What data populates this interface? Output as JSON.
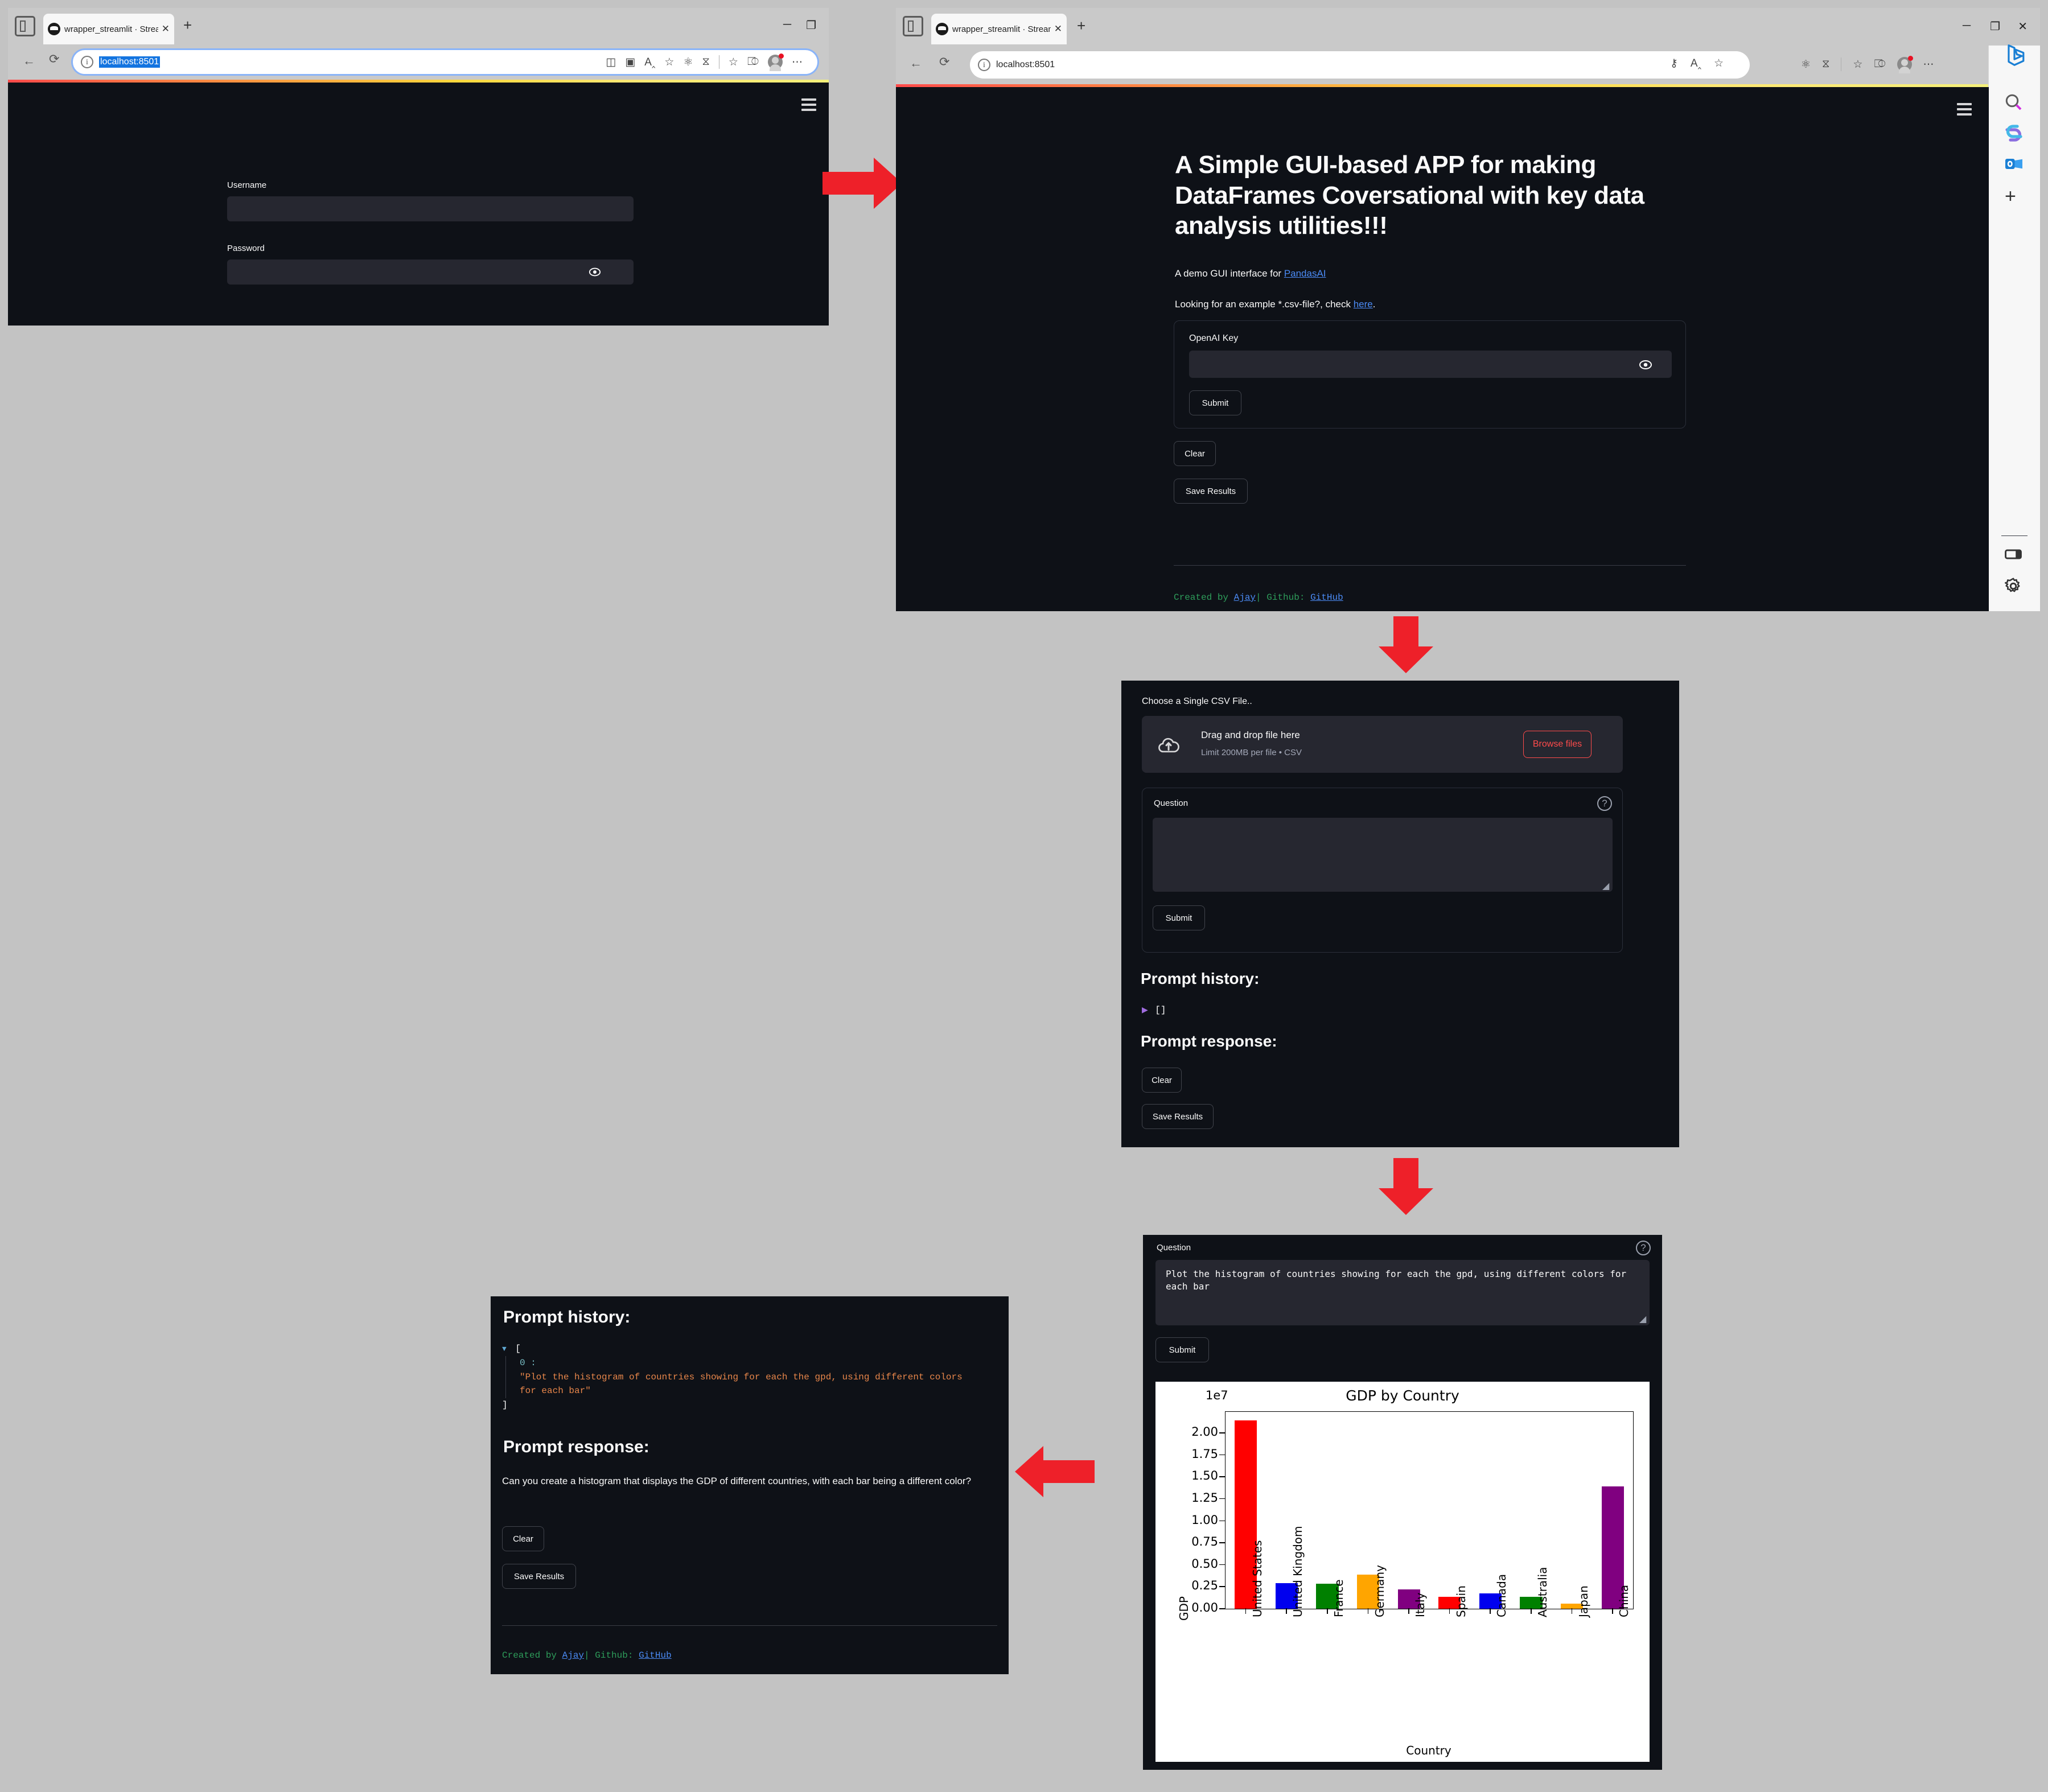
{
  "panel1": {
    "browser": {
      "tab_title": "wrapper_streamlit · Streamlit",
      "tab_close": "✕",
      "new_tab": "+",
      "url": "localhost:8501",
      "minimize": "─",
      "restore": "❐",
      "back_icon": "back-arrow-icon",
      "refresh_icon": "refresh-icon"
    },
    "form": {
      "username_label": "Username",
      "username_value": "",
      "password_label": "Password",
      "password_value": ""
    }
  },
  "panel2": {
    "browser": {
      "tab_title": "wrapper_streamlit · Streamlit",
      "tab_close": "✕",
      "new_tab": "+",
      "url": "localhost:8501",
      "minimize": "─",
      "restore": "❐",
      "close": "✕"
    },
    "hero_title": "A Simple GUI-based APP for making DataFrames Coversational with key data analysis utilities!!!",
    "demo_text_pre": "A demo GUI interface for ",
    "demo_link": "PandasAI",
    "example_text_pre": "Looking for an example *.csv-file?, check ",
    "example_link": "here",
    "example_text_post": ".",
    "openai_key_label": "OpenAI Key",
    "openai_key_value": "",
    "submit_label": "Submit",
    "clear_label": "Clear",
    "save_results_label": "Save Results",
    "footer": {
      "created_by": "Created by",
      "author": "Ajay",
      "separator": "|",
      "github_label": "Github:",
      "github_link": "GitHub"
    }
  },
  "panel3": {
    "file_label": "Choose a Single CSV File..",
    "dropzone_title": "Drag and drop file here",
    "dropzone_limit": "Limit 200MB per file • CSV",
    "browse_label": "Browse files",
    "question_label": "Question",
    "question_value": "",
    "submit_label": "Submit",
    "prompt_history_heading": "Prompt history:",
    "prompt_history_value": "[]",
    "prompt_response_heading": "Prompt response:",
    "clear_label": "Clear",
    "save_results_label": "Save Results"
  },
  "panel4": {
    "question_label": "Question",
    "question_value": "Plot the histogram of countries showing for each the gpd, using different colors for each bar",
    "submit_label": "Submit"
  },
  "panel5": {
    "prompt_history_heading": "Prompt history:",
    "history_open_bracket": "[",
    "history_index": "0 :",
    "history_item": "\"Plot the histogram of countries showing for each the gpd, using different colors for each bar\"",
    "history_close_bracket": "]",
    "prompt_response_heading": "Prompt response:",
    "response_text": "Can you create a histogram that displays the GDP of different countries, with each bar being a different color?",
    "clear_label": "Clear",
    "save_results_label": "Save Results",
    "footer": {
      "created_by": "Created by",
      "author": "Ajay",
      "separator": "|",
      "github_label": "Github:",
      "github_link": "GitHub"
    }
  },
  "flow": {
    "arrow_right_1": "arrow-right-icon",
    "arrow_down_1": "arrow-down-icon",
    "arrow_down_2": "arrow-down-icon",
    "arrow_left_1": "arrow-left-icon"
  },
  "colors": {
    "accent_red": "#ee2029",
    "streamlit_red": "#ff4b4b",
    "page_bg": "#0e1117",
    "input_bg": "#262730",
    "link_blue": "#4b8bf5",
    "desktop_bg": "#c3c3c3"
  },
  "chart_data": {
    "type": "bar",
    "title": "GDP by Country",
    "xlabel": "Country",
    "ylabel": "GDP",
    "offset_text": "1e7",
    "categories": [
      "United States",
      "United Kingdom",
      "France",
      "Germany",
      "Italy",
      "Spain",
      "Canada",
      "Australia",
      "Japan",
      "China"
    ],
    "values": [
      21400000,
      2930000,
      2830000,
      3860000,
      2200000,
      1390000,
      1740000,
      1340000,
      560000,
      13950000
    ],
    "bar_colors": [
      "#ff0000",
      "#0000ee",
      "#008000",
      "#ffa500",
      "#800080",
      "#ff0000",
      "#0000ee",
      "#008000",
      "#ffa500",
      "#800080"
    ],
    "ytick_labels": [
      "0.00",
      "0.25",
      "0.50",
      "0.75",
      "1.00",
      "1.25",
      "1.50",
      "1.75",
      "2.00"
    ],
    "ytick_values": [
      0,
      2500000,
      5000000,
      7500000,
      10000000,
      12500000,
      15000000,
      17500000,
      20000000
    ],
    "ylim": [
      0,
      22400000
    ],
    "grid": false,
    "legend": false
  }
}
